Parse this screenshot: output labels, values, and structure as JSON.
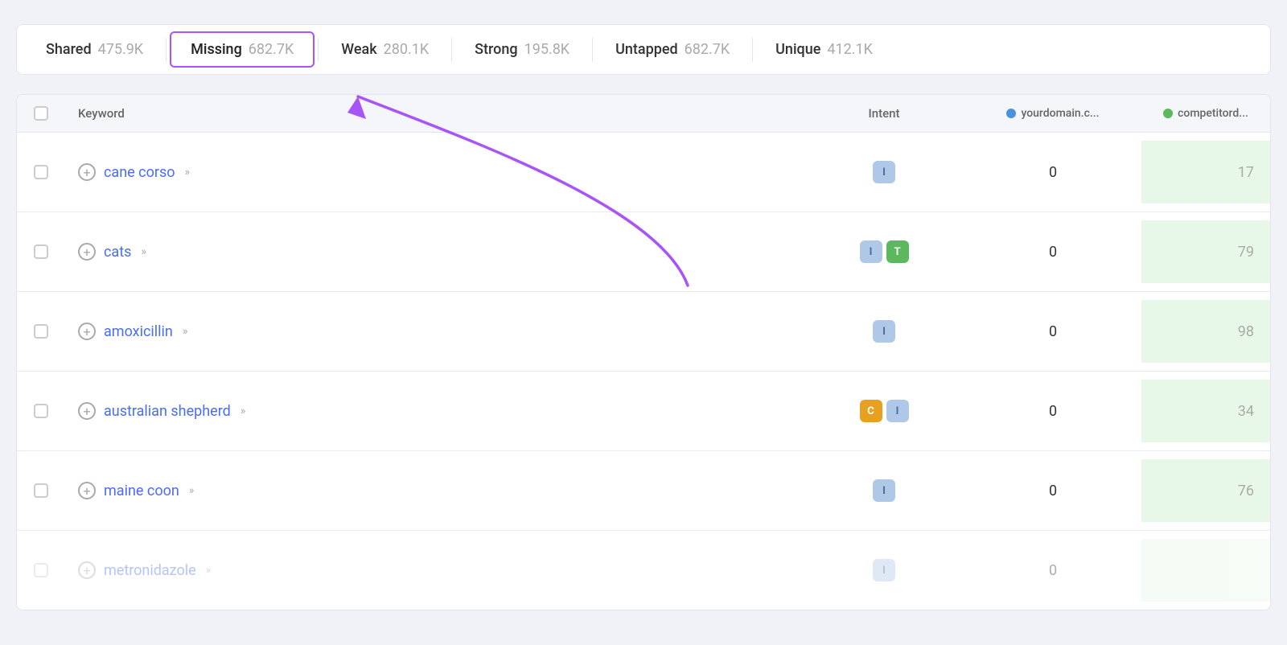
{
  "tabs": [
    {
      "id": "shared",
      "label": "Shared",
      "count": "475.9K",
      "active": false
    },
    {
      "id": "missing",
      "label": "Missing",
      "count": "682.7K",
      "active": true
    },
    {
      "id": "weak",
      "label": "Weak",
      "count": "280.1K",
      "active": false
    },
    {
      "id": "strong",
      "label": "Strong",
      "count": "195.8K",
      "active": false
    },
    {
      "id": "untapped",
      "label": "Untapped",
      "count": "682.7K",
      "active": false
    },
    {
      "id": "unique",
      "label": "Unique",
      "count": "412.1K",
      "active": false
    }
  ],
  "table": {
    "headers": {
      "keyword": "Keyword",
      "intent": "Intent",
      "yourdomain": "yourdomain.c...",
      "competitor": "competitord..."
    },
    "rows": [
      {
        "keyword": "cane corso",
        "intents": [
          {
            "type": "i",
            "label": "I"
          }
        ],
        "yourdomain": "0",
        "competitor": "17"
      },
      {
        "keyword": "cats",
        "intents": [
          {
            "type": "i",
            "label": "I"
          },
          {
            "type": "t",
            "label": "T"
          }
        ],
        "yourdomain": "0",
        "competitor": "79"
      },
      {
        "keyword": "amoxicillin",
        "intents": [
          {
            "type": "i",
            "label": "I"
          }
        ],
        "yourdomain": "0",
        "competitor": "98"
      },
      {
        "keyword": "australian shepherd",
        "intents": [
          {
            "type": "c",
            "label": "C"
          },
          {
            "type": "i",
            "label": "I"
          }
        ],
        "yourdomain": "0",
        "competitor": "34"
      },
      {
        "keyword": "maine coon",
        "intents": [
          {
            "type": "i",
            "label": "I"
          }
        ],
        "yourdomain": "0",
        "competitor": "76"
      },
      {
        "keyword": "metronidazole",
        "intents": [
          {
            "type": "i",
            "label": "I"
          }
        ],
        "yourdomain": "0",
        "competitor": ""
      }
    ]
  },
  "colors": {
    "purple_accent": "#a855f7",
    "blue_dot": "#4a90e2",
    "green_dot": "#5cb85c"
  }
}
